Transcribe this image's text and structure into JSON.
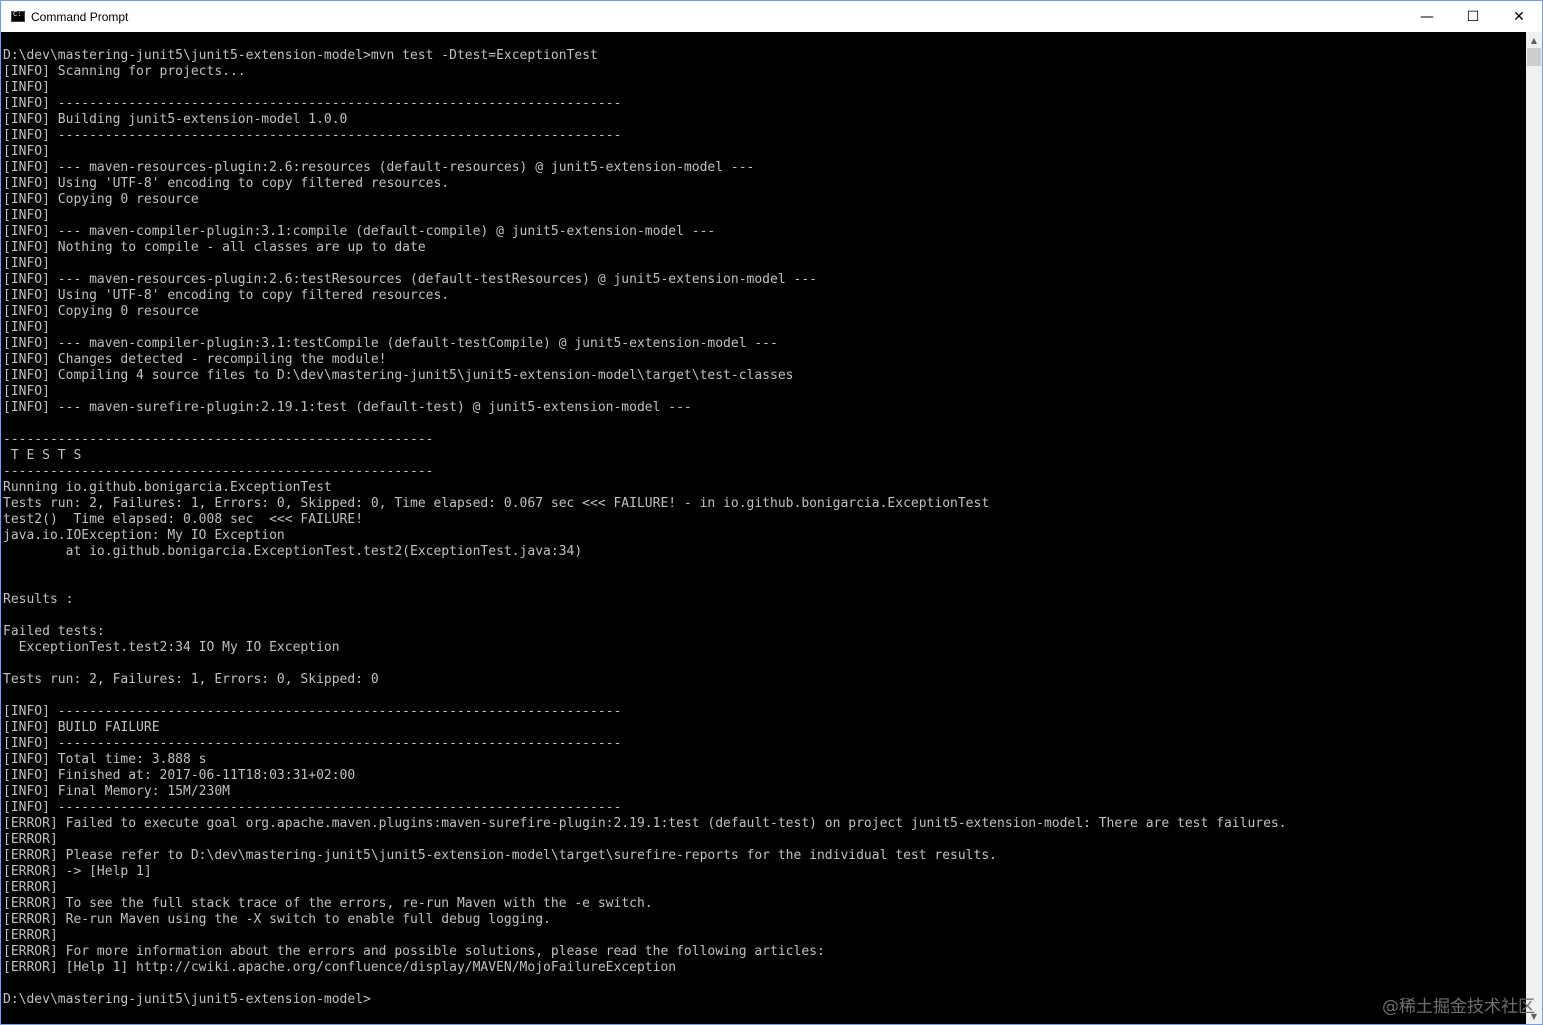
{
  "window": {
    "title": "Command Prompt",
    "minimize_glyph": "—",
    "maximize_glyph": "☐",
    "close_glyph": "✕",
    "icon": "cmd-icon"
  },
  "console": {
    "lines": [
      "D:\\dev\\mastering-junit5\\junit5-extension-model>mvn test -Dtest=ExceptionTest",
      "[INFO] Scanning for projects...",
      "[INFO]",
      "[INFO] ------------------------------------------------------------------------",
      "[INFO] Building junit5-extension-model 1.0.0",
      "[INFO] ------------------------------------------------------------------------",
      "[INFO]",
      "[INFO] --- maven-resources-plugin:2.6:resources (default-resources) @ junit5-extension-model ---",
      "[INFO] Using 'UTF-8' encoding to copy filtered resources.",
      "[INFO] Copying 0 resource",
      "[INFO]",
      "[INFO] --- maven-compiler-plugin:3.1:compile (default-compile) @ junit5-extension-model ---",
      "[INFO] Nothing to compile - all classes are up to date",
      "[INFO]",
      "[INFO] --- maven-resources-plugin:2.6:testResources (default-testResources) @ junit5-extension-model ---",
      "[INFO] Using 'UTF-8' encoding to copy filtered resources.",
      "[INFO] Copying 0 resource",
      "[INFO]",
      "[INFO] --- maven-compiler-plugin:3.1:testCompile (default-testCompile) @ junit5-extension-model ---",
      "[INFO] Changes detected - recompiling the module!",
      "[INFO] Compiling 4 source files to D:\\dev\\mastering-junit5\\junit5-extension-model\\target\\test-classes",
      "[INFO]",
      "[INFO] --- maven-surefire-plugin:2.19.1:test (default-test) @ junit5-extension-model ---",
      "",
      "-------------------------------------------------------",
      " T E S T S",
      "-------------------------------------------------------",
      "Running io.github.bonigarcia.ExceptionTest",
      "Tests run: 2, Failures: 1, Errors: 0, Skipped: 0, Time elapsed: 0.067 sec <<< FAILURE! - in io.github.bonigarcia.ExceptionTest",
      "test2()  Time elapsed: 0.008 sec  <<< FAILURE!",
      "java.io.IOException: My IO Exception",
      "        at io.github.bonigarcia.ExceptionTest.test2(ExceptionTest.java:34)",
      "",
      "",
      "Results :",
      "",
      "Failed tests:",
      "  ExceptionTest.test2:34 IO My IO Exception",
      "",
      "Tests run: 2, Failures: 1, Errors: 0, Skipped: 0",
      "",
      "[INFO] ------------------------------------------------------------------------",
      "[INFO] BUILD FAILURE",
      "[INFO] ------------------------------------------------------------------------",
      "[INFO] Total time: 3.888 s",
      "[INFO] Finished at: 2017-06-11T18:03:31+02:00",
      "[INFO] Final Memory: 15M/230M",
      "[INFO] ------------------------------------------------------------------------",
      "[ERROR] Failed to execute goal org.apache.maven.plugins:maven-surefire-plugin:2.19.1:test (default-test) on project junit5-extension-model: There are test failures.",
      "[ERROR]",
      "[ERROR] Please refer to D:\\dev\\mastering-junit5\\junit5-extension-model\\target\\surefire-reports for the individual test results.",
      "[ERROR] -> [Help 1]",
      "[ERROR]",
      "[ERROR] To see the full stack trace of the errors, re-run Maven with the -e switch.",
      "[ERROR] Re-run Maven using the -X switch to enable full debug logging.",
      "[ERROR]",
      "[ERROR] For more information about the errors and possible solutions, please read the following articles:",
      "[ERROR] [Help 1] http://cwiki.apache.org/confluence/display/MAVEN/MojoFailureException",
      "",
      "D:\\dev\\mastering-junit5\\junit5-extension-model>"
    ]
  },
  "scrollbar": {
    "up_glyph": "▲",
    "down_glyph": "▼"
  },
  "watermark": "@稀土掘金技术社区",
  "colors": {
    "console_bg": "#000000",
    "console_fg": "#c0c0c0",
    "titlebar_bg": "#ffffff",
    "window_border": "#7a9fd4"
  }
}
